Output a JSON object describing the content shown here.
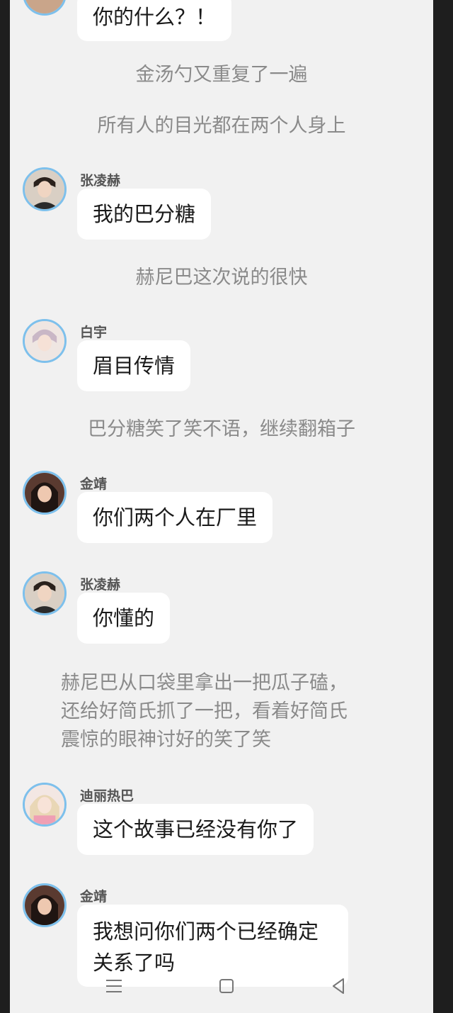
{
  "messages": [
    {
      "type": "chat",
      "sender": "",
      "text": "你的什么？！",
      "avatar_icon": "user-avatar-icon"
    },
    {
      "type": "narration",
      "text": "金汤勺又重复了一遍"
    },
    {
      "type": "narration",
      "text": "所有人的目光都在两个人身上"
    },
    {
      "type": "chat",
      "sender": "张凌赫",
      "text": "我的巴分糖",
      "avatar_icon": "user-avatar-icon"
    },
    {
      "type": "narration",
      "text": "赫尼巴这次说的很快"
    },
    {
      "type": "chat",
      "sender": "白宇",
      "text": "眉目传情",
      "avatar_icon": "user-avatar-icon"
    },
    {
      "type": "narration",
      "text": "巴分糖笑了笑不语，继续翻箱子"
    },
    {
      "type": "chat",
      "sender": "金靖",
      "text": "你们两个人在厂里",
      "avatar_icon": "user-avatar-icon"
    },
    {
      "type": "chat",
      "sender": "张凌赫",
      "text": "你懂的",
      "avatar_icon": "user-avatar-icon"
    },
    {
      "type": "narration",
      "text": "赫尼巴从口袋里拿出一把瓜子磕，\n还给好简氏抓了一把，看着好简氏\n震惊的眼神讨好的笑了笑"
    },
    {
      "type": "chat",
      "sender": "迪丽热巴",
      "text": "这个故事已经没有你了",
      "avatar_icon": "user-avatar-icon"
    },
    {
      "type": "chat",
      "sender": "金靖",
      "text": "我想问你们两个已经确定\n关系了吗",
      "avatar_icon": "user-avatar-icon"
    }
  ],
  "navbar": {
    "menu_icon": "menu-icon",
    "home_icon": "home-icon",
    "back_icon": "back-icon"
  },
  "colors": {
    "background": "#f1f1f1",
    "bubble": "#ffffff",
    "avatar_ring": "#7dc0ec",
    "narration_text": "#8a8a8a"
  }
}
